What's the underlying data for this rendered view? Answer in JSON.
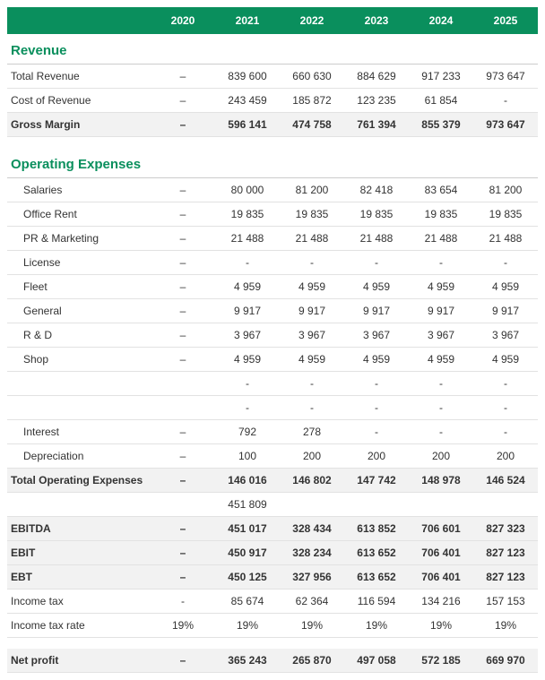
{
  "years": [
    "2020",
    "2021",
    "2022",
    "2023",
    "2024",
    "2025"
  ],
  "revenue": {
    "title": "Revenue",
    "rows": [
      {
        "label": "Total Revenue",
        "vals": [
          "–",
          "839 600",
          "660 630",
          "884 629",
          "917 233",
          "973 647"
        ]
      },
      {
        "label": "Cost of Revenue",
        "vals": [
          "–",
          "243 459",
          "185 872",
          "123 235",
          "61 854",
          "-"
        ]
      }
    ],
    "gross": {
      "label": "Gross Margin",
      "vals": [
        "–",
        "596 141",
        "474 758",
        "761 394",
        "855 379",
        "973 647"
      ]
    }
  },
  "opex": {
    "title": "Operating Expenses",
    "rows": [
      {
        "label": "Salaries",
        "vals": [
          "–",
          "80 000",
          "81 200",
          "82 418",
          "83 654",
          "81 200"
        ]
      },
      {
        "label": "Office Rent",
        "vals": [
          "–",
          "19 835",
          "19 835",
          "19 835",
          "19 835",
          "19 835"
        ]
      },
      {
        "label": "PR & Marketing",
        "vals": [
          "–",
          "21 488",
          "21 488",
          "21 488",
          "21 488",
          "21 488"
        ]
      },
      {
        "label": "License",
        "vals": [
          "–",
          "-",
          "-",
          "-",
          "-",
          "-"
        ]
      },
      {
        "label": "Fleet",
        "vals": [
          "–",
          "4 959",
          "4 959",
          "4 959",
          "4 959",
          "4 959"
        ]
      },
      {
        "label": "General",
        "vals": [
          "–",
          "9 917",
          "9 917",
          "9 917",
          "9 917",
          "9 917"
        ]
      },
      {
        "label": "R & D",
        "vals": [
          "–",
          "3 967",
          "3 967",
          "3 967",
          "3 967",
          "3 967"
        ]
      },
      {
        "label": "Shop",
        "vals": [
          "–",
          "4 959",
          "4 959",
          "4 959",
          "4 959",
          "4 959"
        ]
      },
      {
        "label": "",
        "vals": [
          "",
          "-",
          "-",
          "-",
          "-",
          "-"
        ]
      },
      {
        "label": "",
        "vals": [
          "",
          "-",
          "-",
          "-",
          "-",
          "-"
        ]
      },
      {
        "label": "Interest",
        "vals": [
          "–",
          "792",
          "278",
          "-",
          "-",
          "-"
        ]
      },
      {
        "label": "Depreciation",
        "vals": [
          "–",
          "100",
          "200",
          "200",
          "200",
          "200"
        ]
      }
    ],
    "total": {
      "label": "Total Operating Expenses",
      "vals": [
        "–",
        "146 016",
        "146 802",
        "147 742",
        "148 978",
        "146 524"
      ]
    }
  },
  "mini": {
    "label": "",
    "vals": [
      "",
      "451 809",
      "",
      "",
      "",
      ""
    ]
  },
  "results": [
    {
      "label": "EBITDA",
      "vals": [
        "–",
        "451 017",
        "328 434",
        "613 852",
        "706 601",
        "827 323"
      ],
      "bold": true
    },
    {
      "label": "EBIT",
      "vals": [
        "–",
        "450 917",
        "328 234",
        "613 652",
        "706 401",
        "827 123"
      ],
      "bold": true
    },
    {
      "label": "EBT",
      "vals": [
        "–",
        "450 125",
        "327 956",
        "613 652",
        "706 401",
        "827 123"
      ],
      "bold": true
    },
    {
      "label": "Income tax",
      "vals": [
        "-",
        "85 674",
        "62 364",
        "116 594",
        "134 216",
        "157 153"
      ],
      "bold": false
    },
    {
      "label": "Income tax rate",
      "vals": [
        "19%",
        "19%",
        "19%",
        "19%",
        "19%",
        "19%"
      ],
      "bold": false
    }
  ],
  "net": {
    "label": "Net profit",
    "vals": [
      "–",
      "365 243",
      "265 870",
      "497 058",
      "572 185",
      "669 970"
    ]
  }
}
